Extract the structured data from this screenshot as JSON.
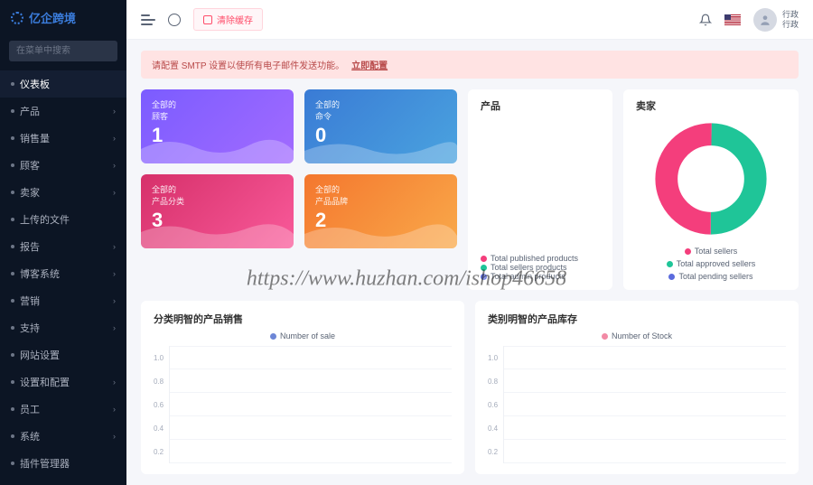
{
  "brand": "亿企跨境",
  "search_placeholder": "在菜单中搜索",
  "sidebar": [
    {
      "l": "仪表板",
      "active": true,
      "expand": false
    },
    {
      "l": "产品",
      "expand": true
    },
    {
      "l": "销售量",
      "expand": true
    },
    {
      "l": "顾客",
      "expand": true
    },
    {
      "l": "卖家",
      "expand": true
    },
    {
      "l": "上传的文件",
      "expand": false
    },
    {
      "l": "报告",
      "expand": true
    },
    {
      "l": "博客系统",
      "expand": true
    },
    {
      "l": "营销",
      "expand": true
    },
    {
      "l": "支持",
      "expand": true
    },
    {
      "l": "网站设置",
      "expand": false
    },
    {
      "l": "设置和配置",
      "expand": true
    },
    {
      "l": "员工",
      "expand": true
    },
    {
      "l": "系统",
      "expand": true
    },
    {
      "l": "插件管理器",
      "expand": false
    }
  ],
  "topbar": {
    "clear_cache": "清除缓存",
    "user_name": "行政",
    "user_role": "行政"
  },
  "alert": {
    "text": "请配置 SMTP 设置以使所有电子邮件发送功能。",
    "link": "立即配置"
  },
  "stats": [
    {
      "sub": "全部的",
      "title": "顾客",
      "num": "1"
    },
    {
      "sub": "全部的",
      "title": "命令",
      "num": "0"
    },
    {
      "sub": "全部的",
      "title": "产品分类",
      "num": "3"
    },
    {
      "sub": "全部的",
      "title": "产品品牌",
      "num": "2"
    }
  ],
  "products_card": {
    "title": "产品",
    "legend": [
      {
        "l": "Total published products",
        "c": "#f43e7c"
      },
      {
        "l": "Total sellers products",
        "c": "#1fc598"
      },
      {
        "l": "Total admin products",
        "c": "#5b6bdd"
      }
    ]
  },
  "sellers_card": {
    "title": "卖家",
    "legend": [
      {
        "l": "Total sellers",
        "c": "#f43e7c"
      },
      {
        "l": "Total approved sellers",
        "c": "#1fc598"
      },
      {
        "l": "Total pending sellers",
        "c": "#5b6bdd"
      }
    ]
  },
  "chart_left": {
    "title": "分类明智的产品销售",
    "legend": "Number of sale",
    "legend_c": "#6d86d6"
  },
  "chart_right": {
    "title": "类别明智的产品库存",
    "legend": "Number of Stock",
    "legend_c": "#f28aa5"
  },
  "chart_data": [
    {
      "type": "bar",
      "title": "分类明智的产品销售",
      "series_name": "Number of sale",
      "ylim": [
        0,
        1
      ],
      "yticks": [
        1.0,
        0.8,
        0.6,
        0.4,
        0.2
      ],
      "categories": [],
      "values": []
    },
    {
      "type": "bar",
      "title": "类别明智的产品库存",
      "series_name": "Number of Stock",
      "ylim": [
        0,
        1
      ],
      "yticks": [
        1.0,
        0.8,
        0.6,
        0.4,
        0.2
      ],
      "categories": [],
      "values": []
    },
    {
      "type": "pie",
      "title": "卖家",
      "series": [
        {
          "name": "Total sellers",
          "value": 50,
          "color": "#f43e7c"
        },
        {
          "name": "Total approved sellers",
          "value": 50,
          "color": "#1fc598"
        },
        {
          "name": "Total pending sellers",
          "value": 0,
          "color": "#5b6bdd"
        }
      ]
    }
  ],
  "watermark": "https://www.huzhan.com/ishop46658"
}
